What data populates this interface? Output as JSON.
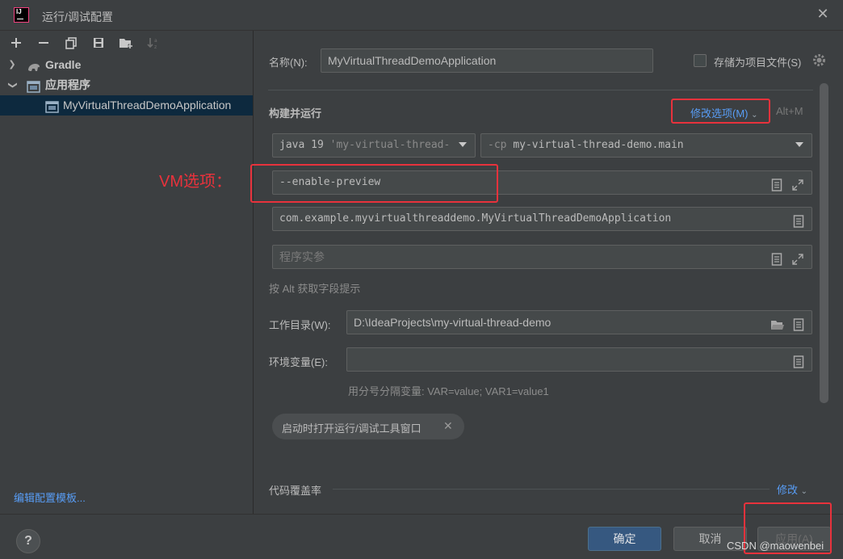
{
  "window": {
    "title": "运行/调试配置"
  },
  "tree": {
    "gradle": "Gradle",
    "application": "应用程序",
    "selected_config": "MyVirtualThreadDemoApplication",
    "edit_templates": "编辑配置模板..."
  },
  "form": {
    "name_label": "名称(N):",
    "name_value": "MyVirtualThreadDemoApplication",
    "store_as_file_label": "存储为项目文件(S)",
    "store_as_file_checked": false,
    "build_run_label": "构建并运行",
    "modify_options_label": "修改选项(M)",
    "modify_options_shortcut": "Alt+M",
    "jre_value": "java 19",
    "jre_hint": "'my-virtual-thread-",
    "classpath_prefix": "-cp",
    "classpath_value": "my-virtual-thread-demo.main",
    "vm_options_value": "--enable-preview",
    "main_class_value": "com.example.myvirtualthreaddemo.MyVirtualThreadDemoApplication",
    "program_args_placeholder": "程序实参",
    "alt_hint": "按 Alt 获取字段提示",
    "workdir_label": "工作目录(W):",
    "workdir_value": "D:\\IdeaProjects\\my-virtual-thread-demo",
    "env_label": "环境变量(E):",
    "env_value": "",
    "env_hint": "用分号分隔变量: VAR=value; VAR1=value1",
    "open_tool_window_chip": "启动时打开运行/调试工具窗口",
    "coverage_label": "代码覆盖率",
    "coverage_modify": "修改"
  },
  "annotation": {
    "vm_label": "VM选项："
  },
  "buttons": {
    "ok": "确定",
    "cancel": "取消",
    "apply": "应用(A)"
  },
  "watermark": "CSDN @maowenbei",
  "colors": {
    "accent": "#589df6",
    "annotation_red": "#e8323c",
    "selection": "#0d293e",
    "primary_button": "#365880"
  }
}
